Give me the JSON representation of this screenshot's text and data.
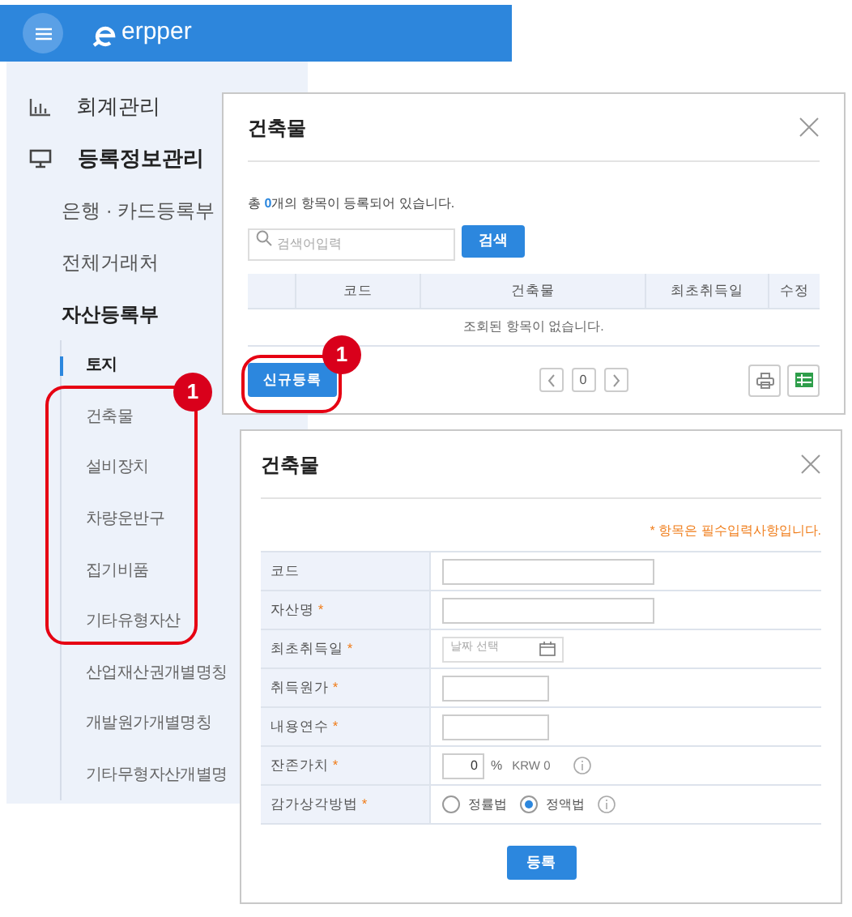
{
  "header": {
    "logo": "erpper"
  },
  "sidebar": {
    "items": [
      {
        "label": "회계관리",
        "kind": "chart",
        "expanded": false
      },
      {
        "label": "등록정보관리",
        "kind": "monitor",
        "expanded": true,
        "children": [
          {
            "label": "은행 · 카드등록부",
            "expanded": false
          },
          {
            "label": "전체거래처",
            "expanded": false
          },
          {
            "label": "자산등록부",
            "expanded": true,
            "children": [
              {
                "label": "토지",
                "selected": true
              },
              {
                "label": "건축물",
                "selected": false
              },
              {
                "label": "설비장치",
                "selected": false
              },
              {
                "label": "차량운반구",
                "selected": false
              },
              {
                "label": "집기비품",
                "selected": false
              },
              {
                "label": "기타유형자산",
                "selected": false
              },
              {
                "label": "산업재산권개별명칭",
                "selected": false
              },
              {
                "label": "개발원가개별명칭",
                "selected": false
              },
              {
                "label": "기타무형자산개별명",
                "selected": false
              }
            ]
          }
        ]
      }
    ]
  },
  "list_dialog": {
    "title": "건축물",
    "summary_prefix": "총 ",
    "count": "0",
    "summary_suffix": "개의 항목이 등록되어 있습니다.",
    "search": {
      "placeholder": "검색어입력"
    },
    "search_button": "검색",
    "table": {
      "columns": [
        "코드",
        "건축물",
        "최초취득일",
        "수정"
      ],
      "empty_message": "조회된 항목이 없습니다."
    },
    "new_button": "신규등록",
    "page": "0"
  },
  "form_dialog": {
    "title": "건축물",
    "required_note": "* 항목은 필수입력사항입니다.",
    "required_mark": "*",
    "fields": [
      {
        "label": "코드",
        "required": false,
        "kind": "text"
      },
      {
        "label": "자산명",
        "required": true,
        "kind": "text"
      },
      {
        "label": "최초취득일",
        "required": true,
        "kind": "date",
        "placeholder": "날짜 선택"
      },
      {
        "label": "취득원가",
        "required": true,
        "kind": "number"
      },
      {
        "label": "내용연수",
        "required": true,
        "kind": "number"
      },
      {
        "label": "잔존가치",
        "required": true,
        "kind": "percent",
        "value": "0",
        "unit": "%",
        "amount": "KRW 0"
      },
      {
        "label": "감가상각방법",
        "required": true,
        "kind": "radio",
        "options": [
          {
            "label": "정률법",
            "selected": false
          },
          {
            "label": "정액법",
            "selected": true
          }
        ]
      }
    ],
    "submit": "등록"
  },
  "callouts": [
    {
      "label": "1"
    },
    {
      "label": "1"
    }
  ]
}
